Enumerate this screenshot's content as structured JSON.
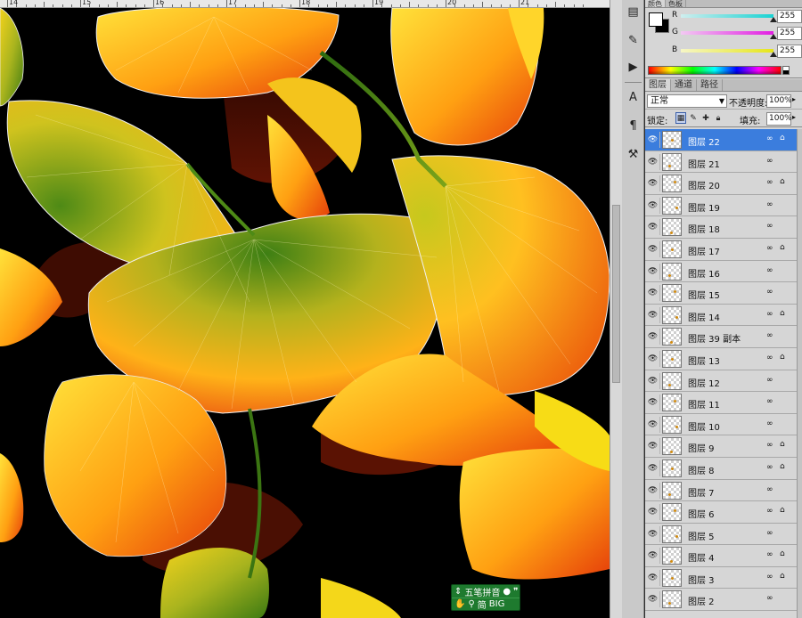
{
  "ruler": {
    "labels": [
      "14",
      "15",
      "16",
      "17",
      "18",
      "19",
      "20",
      "21"
    ]
  },
  "color_panel": {
    "tabs": [
      "颜色",
      "色板"
    ],
    "channels": [
      {
        "label": "R",
        "value": "255",
        "color": "#19d3d3"
      },
      {
        "label": "G",
        "value": "255",
        "color": "#e21ee2"
      },
      {
        "label": "B",
        "value": "255",
        "color": "#e6e61a"
      }
    ],
    "foreground": "#ffffff",
    "background": "#000000"
  },
  "layers_panel": {
    "tabs": [
      "图层",
      "通道",
      "路径"
    ],
    "blend_mode": "正常",
    "opacity_label": "不透明度:",
    "opacity_value": "100%",
    "lock_label": "锁定:",
    "fill_label": "填充:",
    "fill_value": "100%",
    "selected_color": "#3b7ddd",
    "layers": [
      {
        "name": "图层 22",
        "selected": true,
        "linked": true,
        "fx": true
      },
      {
        "name": "图层 21",
        "selected": false,
        "linked": true,
        "fx": false
      },
      {
        "name": "图层 20",
        "selected": false,
        "linked": true,
        "fx": true
      },
      {
        "name": "图层 19",
        "selected": false,
        "linked": true,
        "fx": false
      },
      {
        "name": "图层 18",
        "selected": false,
        "linked": true,
        "fx": false
      },
      {
        "name": "图层 17",
        "selected": false,
        "linked": true,
        "fx": true
      },
      {
        "name": "图层 16",
        "selected": false,
        "linked": true,
        "fx": false
      },
      {
        "name": "图层 15",
        "selected": false,
        "linked": true,
        "fx": false
      },
      {
        "name": "图层 14",
        "selected": false,
        "linked": true,
        "fx": true
      },
      {
        "name": "图层 39 副本",
        "selected": false,
        "linked": true,
        "fx": false
      },
      {
        "name": "图层 13",
        "selected": false,
        "linked": true,
        "fx": true
      },
      {
        "name": "图层 12",
        "selected": false,
        "linked": true,
        "fx": false
      },
      {
        "name": "图层 11",
        "selected": false,
        "linked": true,
        "fx": false
      },
      {
        "name": "图层 10",
        "selected": false,
        "linked": true,
        "fx": false
      },
      {
        "name": "图层 9",
        "selected": false,
        "linked": true,
        "fx": true
      },
      {
        "name": "图层 8",
        "selected": false,
        "linked": true,
        "fx": true
      },
      {
        "name": "图层 7",
        "selected": false,
        "linked": true,
        "fx": false
      },
      {
        "name": "图层 6",
        "selected": false,
        "linked": true,
        "fx": true
      },
      {
        "name": "图层 5",
        "selected": false,
        "linked": true,
        "fx": false
      },
      {
        "name": "图层 4",
        "selected": false,
        "linked": true,
        "fx": true
      },
      {
        "name": "图层 3",
        "selected": false,
        "linked": true,
        "fx": true
      },
      {
        "name": "图层 2",
        "selected": false,
        "linked": true,
        "fx": false
      }
    ]
  },
  "ime": {
    "name": "五笔拼音",
    "mode": "简",
    "row2_extra": "BIG"
  },
  "tool_strip_icons": [
    "history-icon",
    "brush-presets-icon",
    "actions-icon",
    "character-icon",
    "paragraph-icon",
    "tool-presets-icon"
  ]
}
